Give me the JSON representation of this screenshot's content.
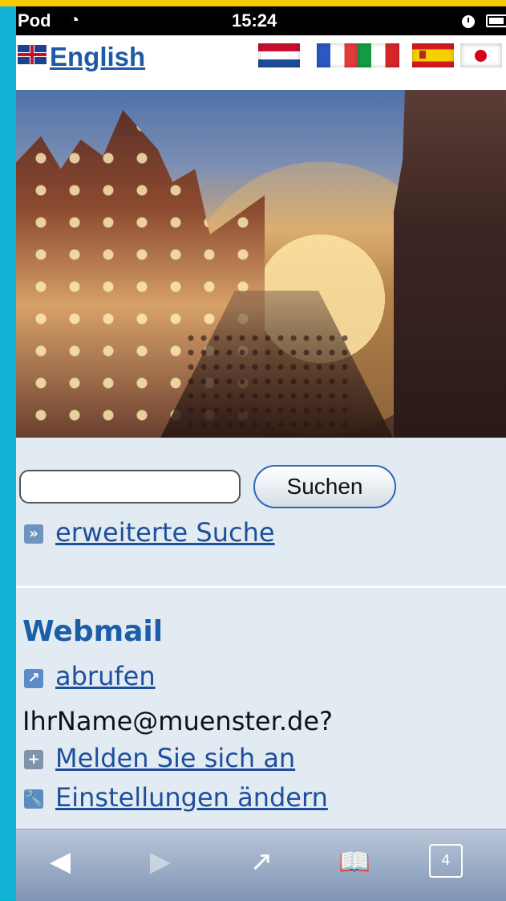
{
  "status_bar": {
    "carrier": "Pod",
    "time": "15:24",
    "wifi_icon": "wifi-icon",
    "clock_icon": "clock-icon",
    "battery_icon": "battery-icon"
  },
  "language_bar": {
    "current_language": "English",
    "flags": [
      "netherlands-flag",
      "france-flag",
      "italy-flag",
      "spain-flag",
      "japan-flag"
    ]
  },
  "search": {
    "input_value": "",
    "button_label": "Suchen",
    "advanced_link": "erweiterte Suche"
  },
  "webmail": {
    "title": "Webmail",
    "fetch_link": "abrufen",
    "email_prompt": "IhrName@muenster.de?",
    "signin_link": "Melden Sie sich an",
    "settings_link": "Einstellungen ändern"
  },
  "toolbar": {
    "back_icon": "back-icon",
    "forward_icon": "forward-icon",
    "share_icon": "share-icon",
    "bookmarks_icon": "bookmarks-icon",
    "pages_count": "4"
  },
  "colors": {
    "accent": "#1e4f9b",
    "frame": "#11b4d4",
    "top_strip": "#f7c900",
    "toolbar": "#8ea1be"
  }
}
